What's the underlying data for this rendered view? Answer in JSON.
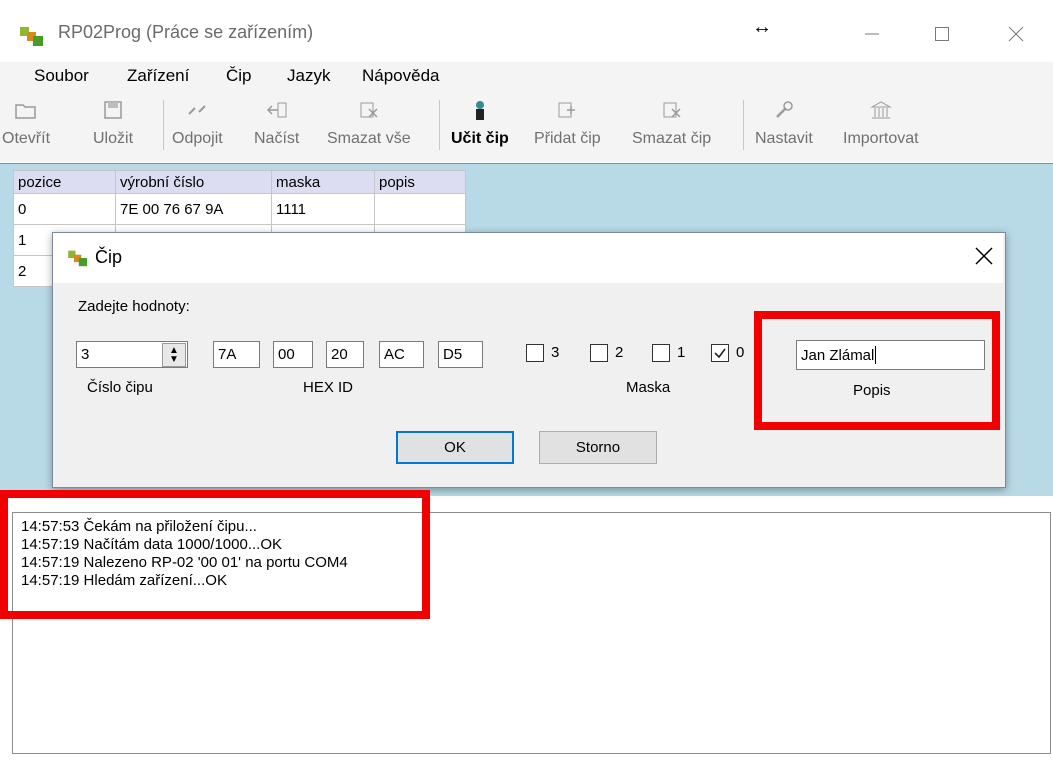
{
  "window": {
    "title": "RP02Prog (Práce se zařízením)"
  },
  "menu": [
    "Soubor",
    "Zařízení",
    "Čip",
    "Jazyk",
    "Nápověda"
  ],
  "toolbar": {
    "open": "Otevřít",
    "save": "Uložit",
    "disconnect": "Odpojit",
    "load": "Načíst",
    "delete_all": "Smazat vše",
    "learn": "Učit čip",
    "add": "Přidat čip",
    "delete": "Smazat čip",
    "settings": "Nastavit",
    "import": "Importovat"
  },
  "table": {
    "headers": [
      "pozice",
      "výrobní číslo",
      "maska",
      "popis"
    ],
    "rows": [
      [
        "0",
        "7E 00 76 67 9A",
        "1111",
        ""
      ],
      [
        "1",
        "",
        "",
        ""
      ],
      [
        "2",
        "",
        "",
        ""
      ]
    ]
  },
  "dialog": {
    "title": "Čip",
    "prompt": "Zadejte hodnoty:",
    "chip_number_value": "3",
    "chip_number_label": "Číslo čipu",
    "hex_values": [
      "7A",
      "00",
      "20",
      "AC",
      "D5"
    ],
    "hex_label": "HEX ID",
    "mask": [
      {
        "label": "3",
        "checked": false
      },
      {
        "label": "2",
        "checked": false
      },
      {
        "label": "1",
        "checked": false
      },
      {
        "label": "0",
        "checked": true
      }
    ],
    "mask_label": "Maska",
    "description_value": "Jan Zlámal",
    "description_label": "Popis",
    "ok": "OK",
    "cancel": "Storno"
  },
  "log": [
    "14:57:53  Čekám na přiložení čipu...",
    "14:57:19  Načítám data 1000/1000...OK",
    "14:57:19  Nalezeno RP-02 '00 01' na portu COM4",
    "14:57:19  Hledám zařízení...OK"
  ],
  "colors": {
    "highlight": "#f00000",
    "grid_background": "#b8dae7",
    "header_background": "#dcdcf3"
  }
}
